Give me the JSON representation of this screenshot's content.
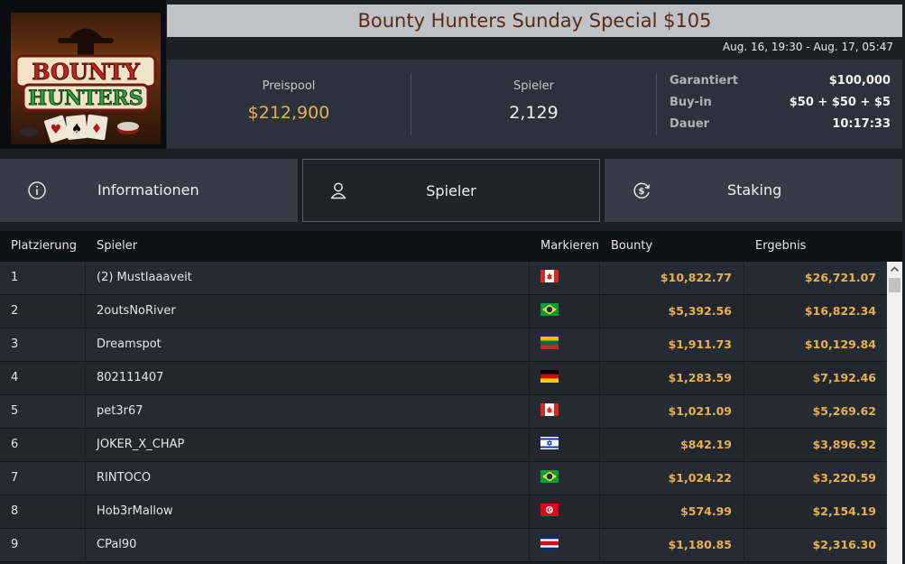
{
  "tournament": {
    "title": "Bounty Hunters Sunday Special $105",
    "dates": "Aug. 16, 19:30 - Aug. 17, 05:47",
    "logo_text_top": "BOUNTY",
    "logo_text_bottom": "HUNTERS"
  },
  "stats": {
    "prizepool_label": "Preispool",
    "prizepool_value": "$212,900",
    "players_label": "Spieler",
    "players_value": "2,129"
  },
  "details": [
    {
      "label": "Garantiert",
      "value": "$100,000"
    },
    {
      "label": "Buy-in",
      "value": "$50 + $50 + $5"
    },
    {
      "label": "Dauer",
      "value": "10:17:33"
    }
  ],
  "tabs": {
    "info": "Informationen",
    "players": "Spieler",
    "staking": "Staking"
  },
  "table": {
    "headers": {
      "rank": "Platzierung",
      "player": "Spieler",
      "mark": "Markieren",
      "bounty": "Bounty",
      "result": "Ergebnis"
    },
    "rows": [
      {
        "rank": "1",
        "name": "(2) Mustlaaaveit",
        "flag": "canada",
        "bounty": "$10,822.77",
        "result": "$26,721.07"
      },
      {
        "rank": "2",
        "name": "2outsNoRiver",
        "flag": "brazil",
        "bounty": "$5,392.56",
        "result": "$16,822.34"
      },
      {
        "rank": "3",
        "name": "Dreamspot",
        "flag": "lithuania",
        "bounty": "$1,911.73",
        "result": "$10,129.84"
      },
      {
        "rank": "4",
        "name": "802111407",
        "flag": "germany",
        "bounty": "$1,283.59",
        "result": "$7,192.46"
      },
      {
        "rank": "5",
        "name": "pet3r67",
        "flag": "canada",
        "bounty": "$1,021.09",
        "result": "$5,269.62"
      },
      {
        "rank": "6",
        "name": "JOKER_X_CHAP",
        "flag": "israel",
        "bounty": "$842.19",
        "result": "$3,896.92"
      },
      {
        "rank": "7",
        "name": "RINTOCO",
        "flag": "brazil",
        "bounty": "$1,024.22",
        "result": "$3,220.59"
      },
      {
        "rank": "8",
        "name": "Hob3rMallow",
        "flag": "tunisia",
        "bounty": "$574.99",
        "result": "$2,154.19"
      },
      {
        "rank": "9",
        "name": "CPal90",
        "flag": "costa-rica",
        "bounty": "$1,180.85",
        "result": "$2,316.30"
      }
    ]
  },
  "colors": {
    "accent_gold": "#e8b04e",
    "title_text": "#5b2a12"
  }
}
